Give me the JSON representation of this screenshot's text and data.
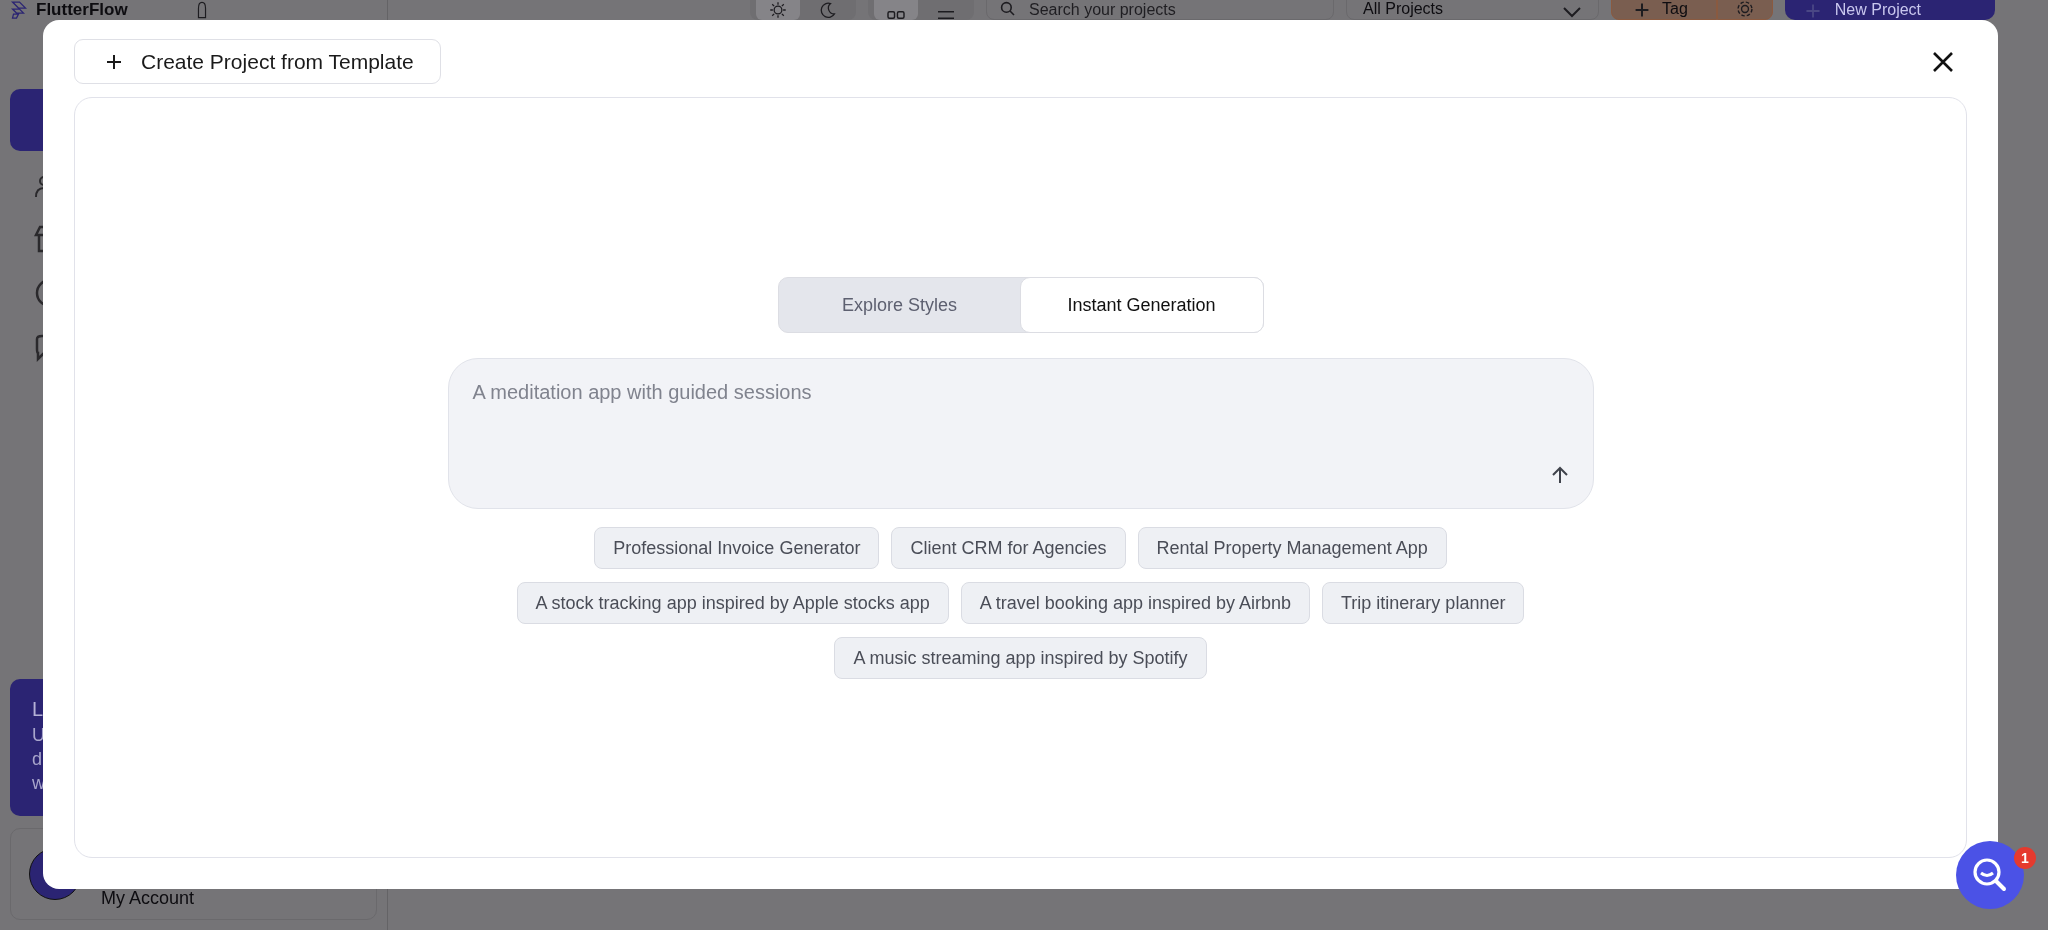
{
  "app": {
    "logo_text": "FlutterFlow",
    "sidebar": {
      "banner_lines": [
        "L",
        "U",
        "d",
        "w"
      ],
      "account_label": "My Account"
    },
    "toolbar": {
      "theme_modes": [
        {
          "kind": "light",
          "selected": true
        },
        {
          "kind": "dark",
          "selected": false
        }
      ],
      "view_modes": [
        {
          "kind": "grid",
          "selected": true
        },
        {
          "kind": "list",
          "selected": false
        }
      ],
      "search": {
        "placeholder": "Search your projects"
      },
      "filter": "All Projects",
      "tag_button": "Tag",
      "new_project_button": "New Project"
    }
  },
  "modal": {
    "template_button": "Create Project from Template",
    "tabs": [
      {
        "label": "Explore Styles",
        "selected": false
      },
      {
        "label": "Instant Generation",
        "selected": true
      }
    ],
    "prompt": {
      "placeholder": "A meditation app with guided sessions"
    },
    "suggestion_rows": [
      [
        "Professional Invoice Generator",
        "Client CRM for Agencies",
        "Rental Property Management App"
      ],
      [
        "A stock tracking app inspired by Apple stocks app",
        "A travel booking app inspired by Airbnb",
        "Trip itinerary planner"
      ],
      [
        "A music streaming app inspired by Spotify"
      ]
    ]
  },
  "help_launcher": {
    "badge": "1"
  }
}
